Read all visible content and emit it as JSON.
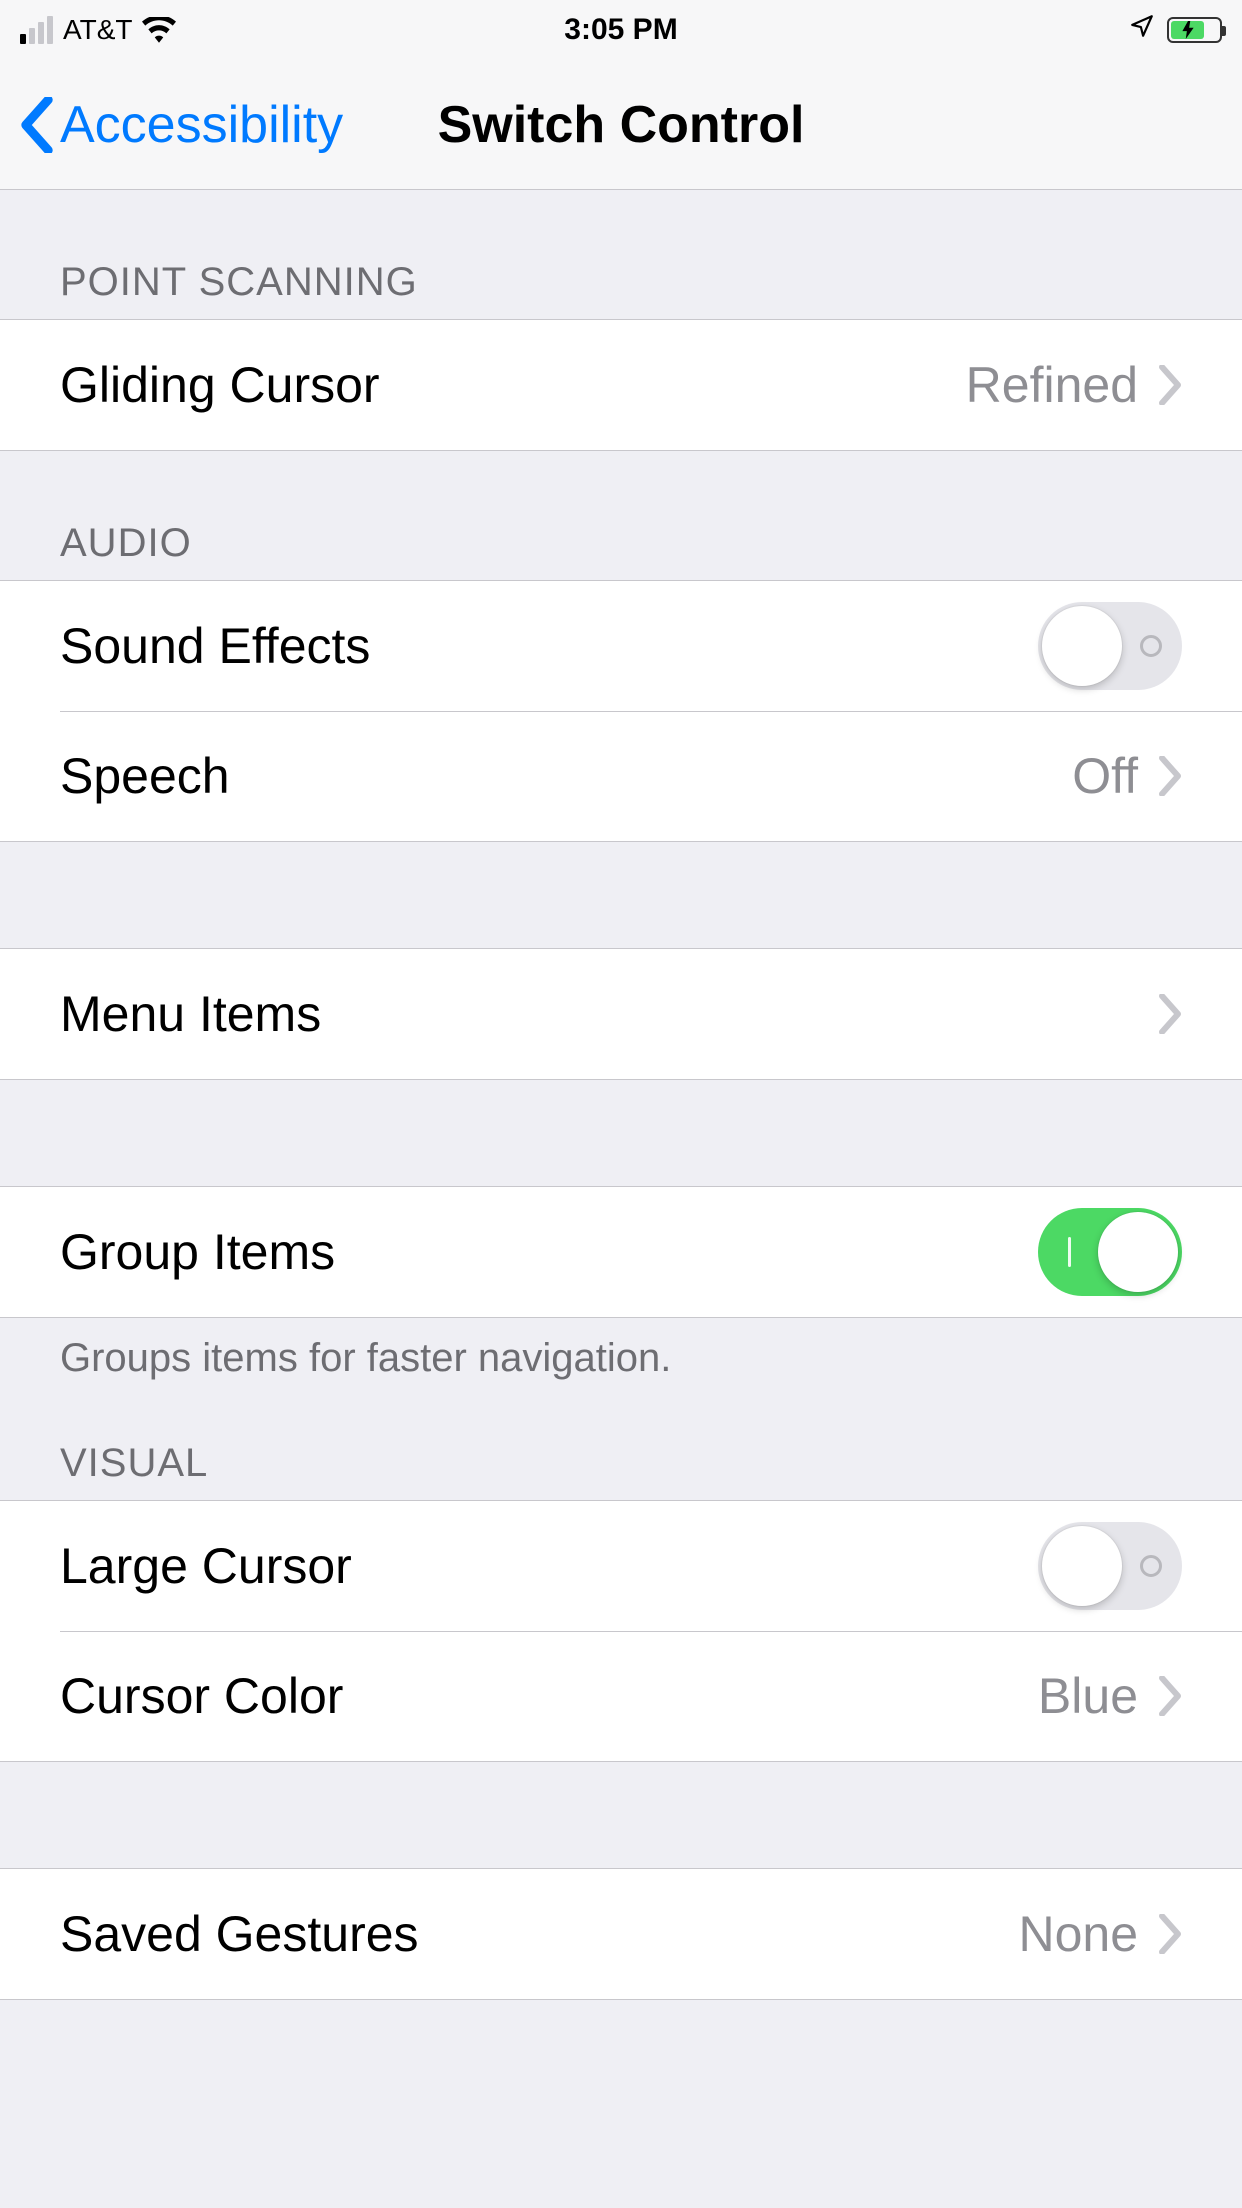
{
  "statusBar": {
    "carrier": "AT&T",
    "time": "3:05 PM"
  },
  "nav": {
    "backLabel": "Accessibility",
    "title": "Switch Control"
  },
  "sections": {
    "pointScanning": {
      "header": "POINT SCANNING",
      "glidingCursor": {
        "label": "Gliding Cursor",
        "value": "Refined"
      }
    },
    "audio": {
      "header": "AUDIO",
      "soundEffects": {
        "label": "Sound Effects",
        "on": false
      },
      "speech": {
        "label": "Speech",
        "value": "Off"
      }
    },
    "menu": {
      "menuItems": {
        "label": "Menu Items"
      }
    },
    "groupItems": {
      "label": "Group Items",
      "on": true,
      "footer": "Groups items for faster navigation."
    },
    "visual": {
      "header": "VISUAL",
      "largeCursor": {
        "label": "Large Cursor",
        "on": false
      },
      "cursorColor": {
        "label": "Cursor Color",
        "value": "Blue"
      }
    },
    "saved": {
      "savedGestures": {
        "label": "Saved Gestures",
        "value": "None"
      }
    }
  }
}
